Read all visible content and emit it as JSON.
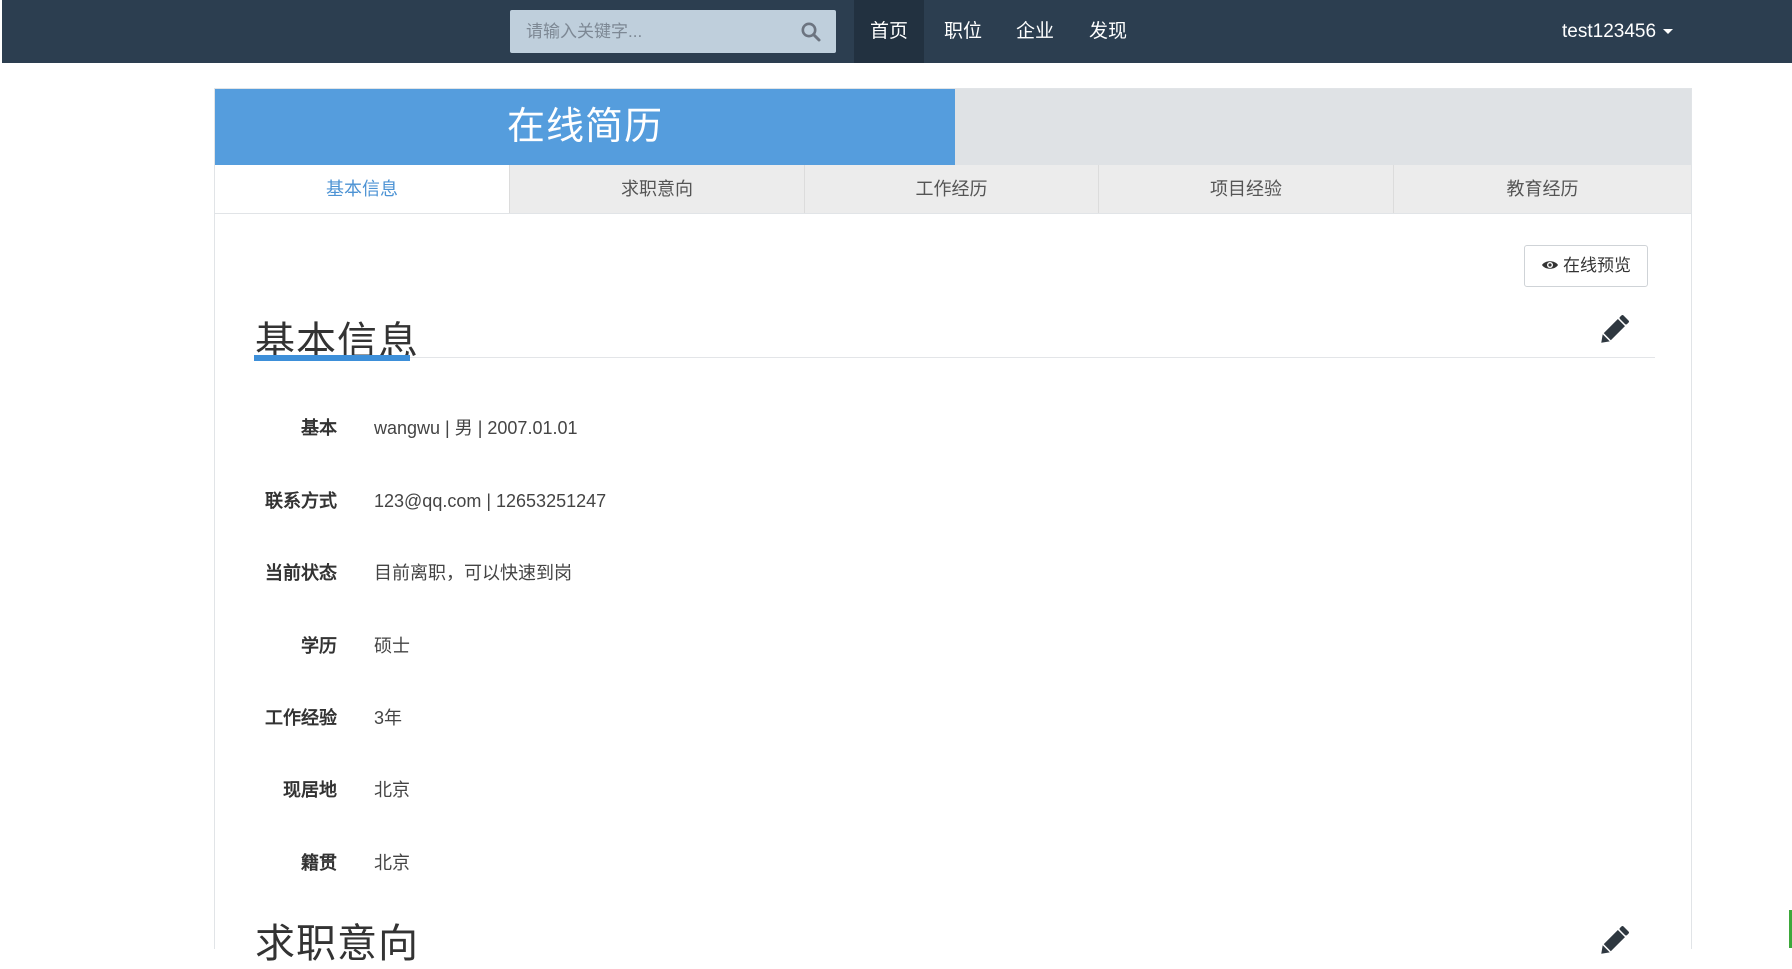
{
  "search": {
    "placeholder": "请输入关键字..."
  },
  "nav": {
    "items": [
      {
        "label": "首页"
      },
      {
        "label": "职位"
      },
      {
        "label": "企业"
      },
      {
        "label": "发现"
      }
    ],
    "user": "test123456"
  },
  "banner": {
    "title": "在线简历"
  },
  "tabs": [
    {
      "label": "基本信息"
    },
    {
      "label": "求职意向"
    },
    {
      "label": "工作经历"
    },
    {
      "label": "项目经验"
    },
    {
      "label": "教育经历"
    }
  ],
  "preview_button": {
    "label": "在线预览"
  },
  "basic": {
    "title": "基本信息",
    "rows": [
      {
        "label": "基本",
        "value": "wangwu  |   男   |   2007.01.01"
      },
      {
        "label": "联系方式",
        "value": "123@qq.com  |  12653251247"
      },
      {
        "label": "当前状态",
        "value": "目前离职，可以快速到岗"
      },
      {
        "label": "学历",
        "value": "硕士"
      },
      {
        "label": "工作经验",
        "value": "3年"
      },
      {
        "label": "现居地",
        "value": "北京"
      },
      {
        "label": "籍贯",
        "value": "北京"
      }
    ]
  },
  "next_section": {
    "title": "求职意向"
  },
  "colors": {
    "topbar": "#2c3e50",
    "banner_blue": "#559ddd",
    "accent": "#3d8fd9",
    "active_tab_text": "#4d93d4"
  },
  "icons": [
    "search-icon",
    "caret-down-icon",
    "eye-icon",
    "pencil-icon"
  ]
}
